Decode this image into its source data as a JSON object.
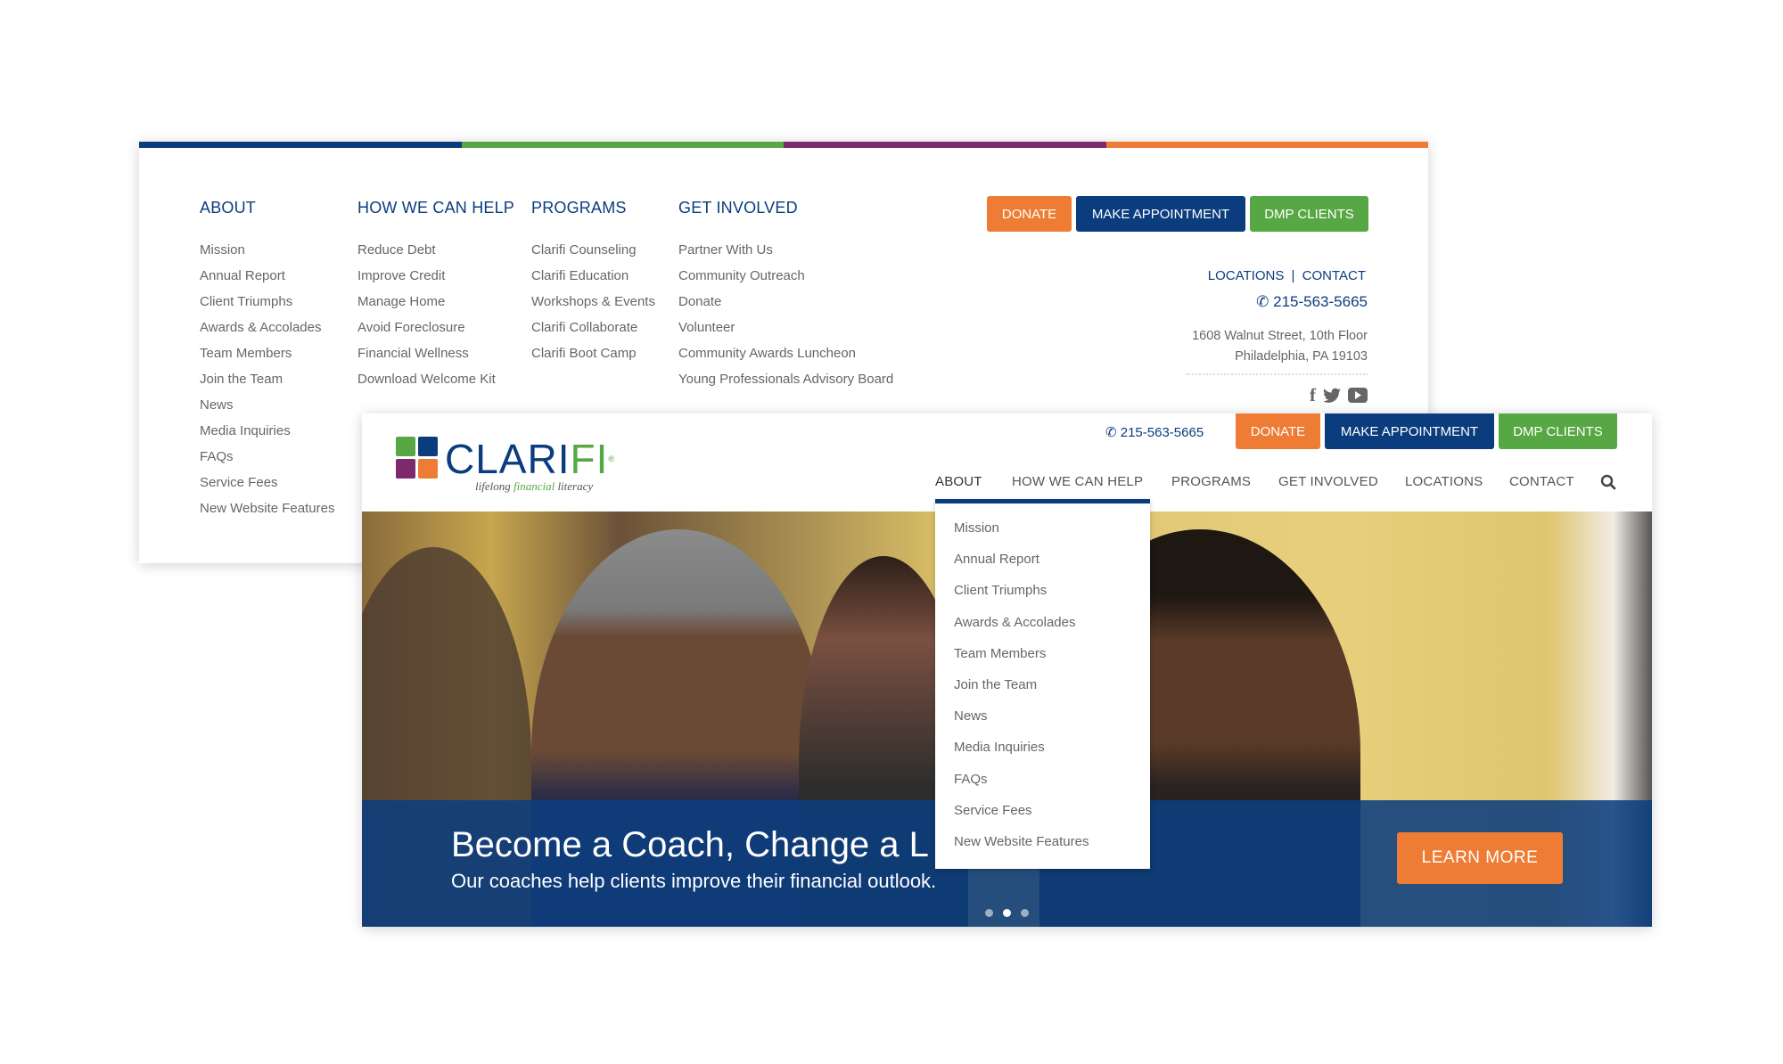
{
  "colors": {
    "navy": "#0b3d7e",
    "green": "#57a845",
    "purple": "#7b2a6e",
    "orange": "#ee7c34"
  },
  "footer_menu": {
    "columns": [
      {
        "heading": "ABOUT",
        "links": [
          "Mission",
          "Annual Report",
          "Client Triumphs",
          "Awards & Accolades",
          "Team Members",
          "Join the Team",
          "News",
          "Media Inquiries",
          "FAQs",
          "Service Fees",
          "New Website Features"
        ]
      },
      {
        "heading": "HOW WE CAN HELP",
        "links": [
          "Reduce Debt",
          "Improve Credit",
          "Manage Home",
          "Avoid Foreclosure",
          "Financial Wellness",
          "Download Welcome Kit"
        ]
      },
      {
        "heading": "PROGRAMS",
        "links": [
          "Clarifi Counseling",
          "Clarifi Education",
          "Workshops & Events",
          "Clarifi Collaborate",
          "Clarifi Boot Camp"
        ]
      },
      {
        "heading": "GET INVOLVED",
        "links": [
          "Partner With Us",
          "Community Outreach",
          "Donate",
          "Volunteer",
          "Community Awards Luncheon",
          "Young Professionals Advisory Board"
        ]
      }
    ],
    "buttons": {
      "donate": "DONATE",
      "appointment": "MAKE APPOINTMENT",
      "dmp": "DMP CLIENTS"
    },
    "locations": "LOCATIONS",
    "separator": "|",
    "contact": "CONTACT",
    "phone": "215-563-5665",
    "address_line1": "1608 Walnut Street, 10th Floor",
    "address_line2": "Philadelphia, PA 19103",
    "social": [
      "facebook-icon",
      "twitter-icon",
      "youtube-icon"
    ]
  },
  "header": {
    "logo_text_a": "CLARI",
    "logo_text_b": "FI",
    "logo_reg": "®",
    "tagline_a": "lifelong",
    "tagline_b": "financial",
    "tagline_c": "literacy",
    "phone": "215-563-5665",
    "buttons": {
      "donate": "DONATE",
      "appointment": "MAKE APPOINTMENT",
      "dmp": "DMP CLIENTS"
    },
    "nav": [
      "ABOUT",
      "HOW WE CAN HELP",
      "PROGRAMS",
      "GET INVOLVED",
      "LOCATIONS",
      "CONTACT"
    ],
    "active_nav": "ABOUT"
  },
  "dropdown": [
    "Mission",
    "Annual Report",
    "Client Triumphs",
    "Awards & Accolades",
    "Team Members",
    "Join the Team",
    "News",
    "Media Inquiries",
    "FAQs",
    "Service Fees",
    "New Website Features"
  ],
  "hero": {
    "headline": "Become a Coach, Change a L",
    "subtitle": "Our coaches help clients improve their financial outlook.",
    "cta": "LEARN MORE",
    "slides": 3,
    "active_slide": 2
  }
}
